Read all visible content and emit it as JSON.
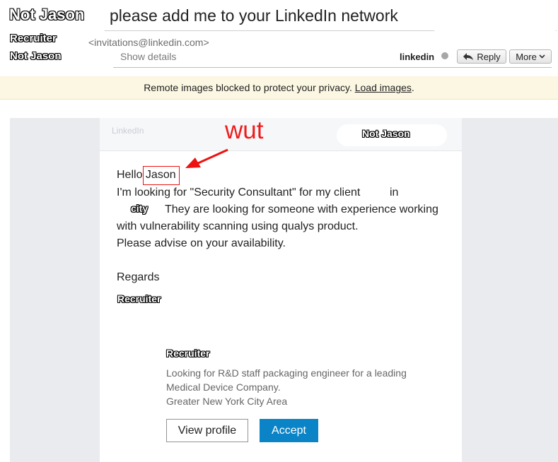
{
  "header": {
    "sender_name": "Not Jason",
    "subject": "please add me to your LinkedIn network",
    "from_name_line1": "Recruiter",
    "from_name_line2": "Not Jason",
    "from_address": "<invitations@linkedin.com>",
    "show_details": "Show details",
    "tag": "linkedin",
    "reply_label": "Reply",
    "more_label": "More"
  },
  "notice": {
    "text": "Remote images blocked to protect your privacy.",
    "link": "Load images",
    "suffix": "."
  },
  "email": {
    "brand": "LinkedIn",
    "annotation": "wut",
    "recipient_label": "Not Jason",
    "greeting": "Hello",
    "greeting_name": "Jason",
    "line1": "I'm looking for \"Security Consultant\" for my client",
    "line1_end": "in",
    "city_label": "city",
    "line2": "They are looking for someone with experience working",
    "line3": "with vulnerability scanning using qualys product.",
    "line4": "Please advise on your availability.",
    "regards": "Regards",
    "signature": "Recruiter"
  },
  "profile": {
    "name": "Recruiter",
    "desc_line1": "Looking for R&D staff packaging engineer for a leading",
    "desc_line2": "Medical Device Company.",
    "desc_line3": "Greater New York City Area",
    "view_label": "View profile",
    "accept_label": "Accept"
  },
  "colors": {
    "accept": "#0a84c6",
    "annotation_red": "#ee1c1c",
    "notice_bg": "#fbf7e2"
  }
}
